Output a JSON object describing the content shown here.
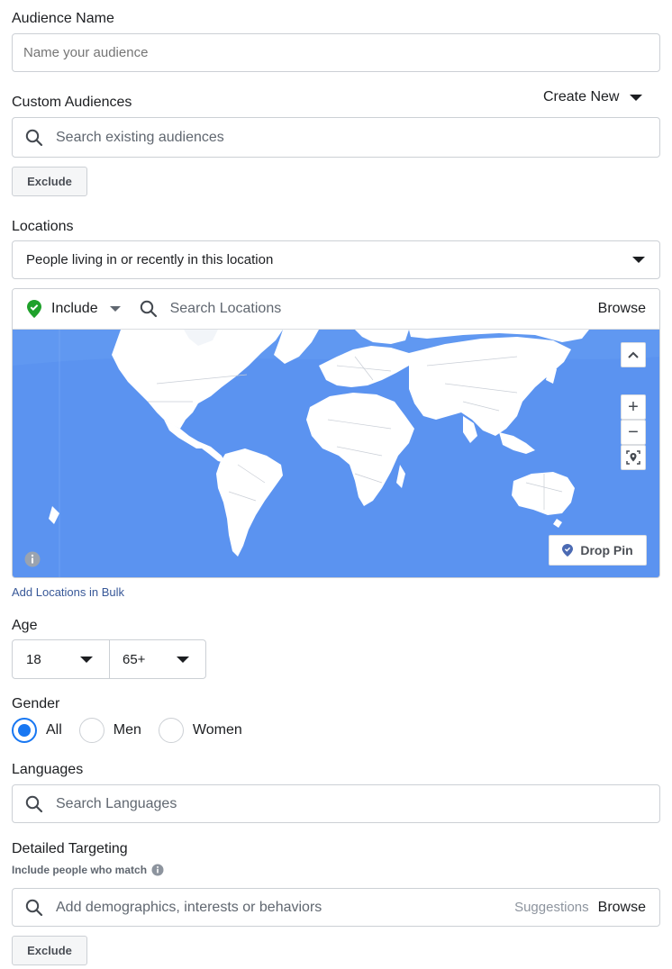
{
  "audience_name": {
    "label": "Audience Name",
    "placeholder": "Name your audience"
  },
  "custom_audiences": {
    "label": "Custom Audiences",
    "create_new": "Create New",
    "search_placeholder": "Search existing audiences",
    "exclude_label": "Exclude"
  },
  "locations": {
    "label": "Locations",
    "type_value": "People living in or recently in this location",
    "include_label": "Include",
    "search_placeholder": "Search Locations",
    "browse_label": "Browse",
    "drop_pin_label": "Drop Pin",
    "add_bulk_label": "Add Locations in Bulk",
    "map_zoom_in": "+",
    "map_zoom_out": "−"
  },
  "age": {
    "label": "Age",
    "min": "18",
    "max": "65+"
  },
  "gender": {
    "label": "Gender",
    "options": [
      "All",
      "Men",
      "Women"
    ],
    "selected": "All"
  },
  "languages": {
    "label": "Languages",
    "search_placeholder": "Search Languages"
  },
  "detailed_targeting": {
    "label": "Detailed Targeting",
    "sublabel": "Include people who match",
    "search_placeholder": "Add demographics, interests or behaviors",
    "suggestions_label": "Suggestions",
    "browse_label": "Browse",
    "exclude_label": "Exclude"
  },
  "colors": {
    "primary": "#1877f2",
    "map_ocean": "#5b93f0",
    "map_land": "#ffffff",
    "include_green": "#1fa12b",
    "link": "#385898"
  }
}
